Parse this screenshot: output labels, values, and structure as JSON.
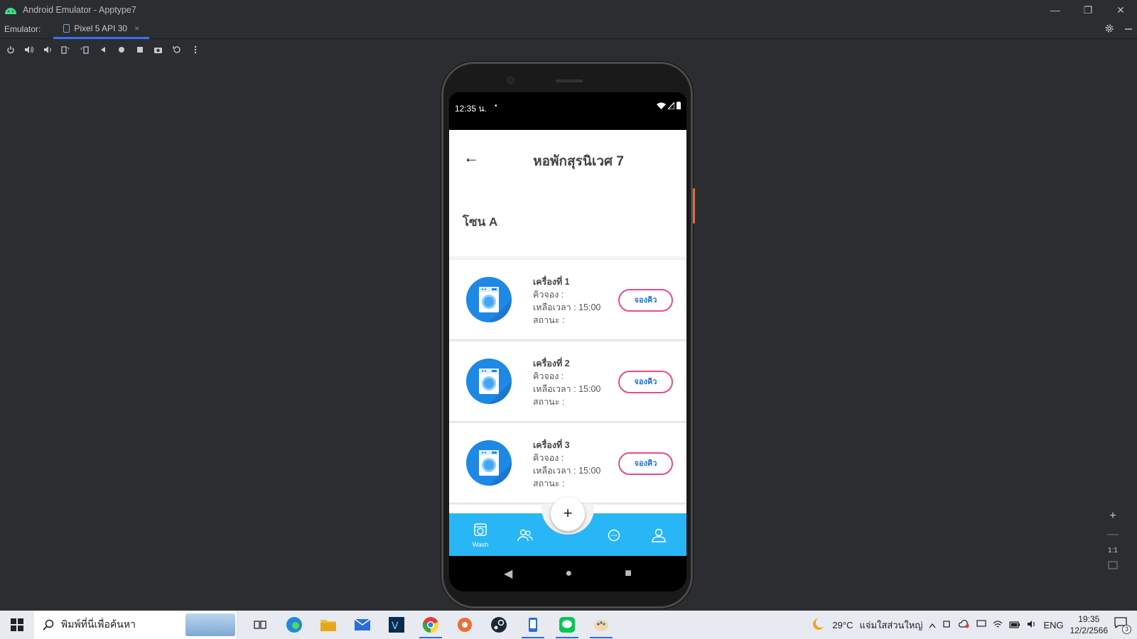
{
  "window": {
    "title": "Android Emulator - Apptype7",
    "minimize": "—",
    "restore": "❐",
    "close": "✕"
  },
  "tabbar": {
    "label": "Emulator:",
    "device_tab": "Pixel 5 API 30",
    "tab_close": "×"
  },
  "phone": {
    "status": {
      "time": "12:35 น.",
      "dot": "•"
    },
    "app_title": "หอพักสุรนิเวศ 7",
    "back_glyph": "←",
    "zone": "โซน A",
    "machines": [
      {
        "name": "เครื่องที่ 1",
        "queue": "คิวจอง :",
        "time_left": "เหลือเวลา : 15:00",
        "status": "สถานะ :",
        "button": "จองคิว"
      },
      {
        "name": "เครื่องที่ 2",
        "queue": "คิวจอง :",
        "time_left": "เหลือเวลา : 15:00",
        "status": "สถานะ :",
        "button": "จองคิว"
      },
      {
        "name": "เครื่องที่ 3",
        "queue": "คิวจอง :",
        "time_left": "เหลือเวลา : 15:00",
        "status": "สถานะ :",
        "button": "จองคิว"
      }
    ],
    "fab": "+",
    "nav": {
      "wash_label": "Wash"
    },
    "sysnav": {
      "back": "◀",
      "home": "●",
      "recents": "■"
    }
  },
  "zoom": {
    "plus": "+",
    "minus": "—",
    "one_to_one": "1:1"
  },
  "taskbar": {
    "search_placeholder": "พิมพ์ที่นี่เพื่อค้นหา",
    "weather": "29°C",
    "weather_desc": "แจ่มใสส่วนใหญ่",
    "lang": "ENG",
    "time": "19:35",
    "date": "12/2/2566",
    "notif_count": "3"
  },
  "colors": {
    "accent_blue": "#29b6f6",
    "book_border": "#e84a8c",
    "book_text": "#1e74d4",
    "washer_blue": "#1e88e5"
  }
}
